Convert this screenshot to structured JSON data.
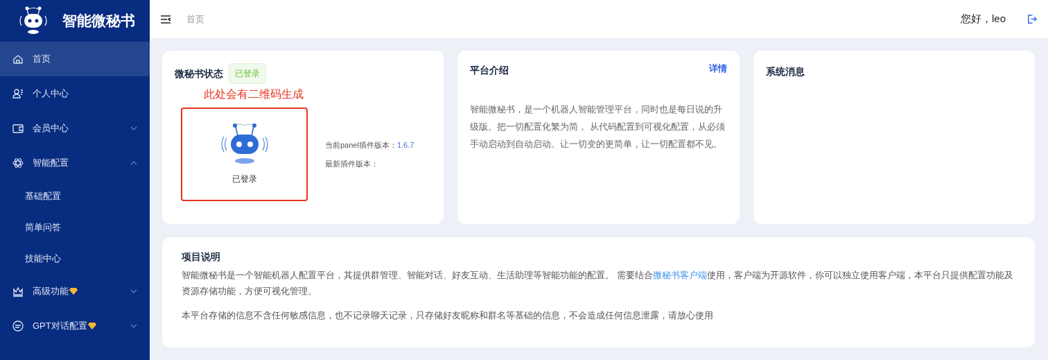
{
  "sidebar": {
    "logo_text": "智能微秘书",
    "items": [
      {
        "kind": "item",
        "label": "首页",
        "selected": true
      },
      {
        "kind": "item",
        "label": "个人中心",
        "selected": false
      },
      {
        "kind": "group",
        "label": "会员中心",
        "selected": false,
        "expanded": false
      },
      {
        "kind": "group",
        "label": "智能配置",
        "selected": false,
        "expanded": true,
        "children": [
          {
            "label": "基础配置",
            "selected": false
          },
          {
            "label": "简单问答",
            "selected": false
          },
          {
            "label": "技能中心",
            "selected": false
          }
        ]
      },
      {
        "kind": "group",
        "label": "高级功能",
        "selected": false,
        "expanded": false,
        "vip": true
      },
      {
        "kind": "group",
        "label": "GPT对话配置",
        "selected": false,
        "expanded": false,
        "vip": true
      }
    ]
  },
  "header": {
    "breadcrumb": "首页",
    "greeting": "您好，leo"
  },
  "status_card": {
    "title": "微秘书状态",
    "badge": "已登录",
    "annotation": "此处会有二维码生成",
    "qr_caption": "已登录",
    "versions": [
      {
        "label": "当前panel插件版本：",
        "value": "1.6.7"
      },
      {
        "label": "最新插件版本："
      }
    ]
  },
  "intro_card": {
    "title": "平台介绍",
    "link": "详情",
    "text": "智能微秘书，是一个机器人智能管理平台，同时也是每日说的升级版。把一切配置化繁为简， 从代码配置到可视化配置，从必须手动启动到自动启动。让一切变的更简单，让一切配置都不见。"
  },
  "messages_card": {
    "title": "系统消息"
  },
  "project_card": {
    "title": "项目说明",
    "paragraph_1_before": "智能微秘书是一个智能机器人配置平台，其提供群管理、智能对话、好友互动、生活助理等智能功能的配置。 需要结合",
    "paragraph_1_link": "微秘书客户端",
    "paragraph_1_after": "使用，客户端为开源软件，你可以独立使用客户端，本平台只提供配置功能及资源存储功能，方便可视化管理。",
    "paragraph_2": "本平台存储的信息不含任何敏感信息，也不记录聊天记录，只存储好友昵称和群名等基础的信息，不会造成任何信息泄露，请放心使用"
  }
}
